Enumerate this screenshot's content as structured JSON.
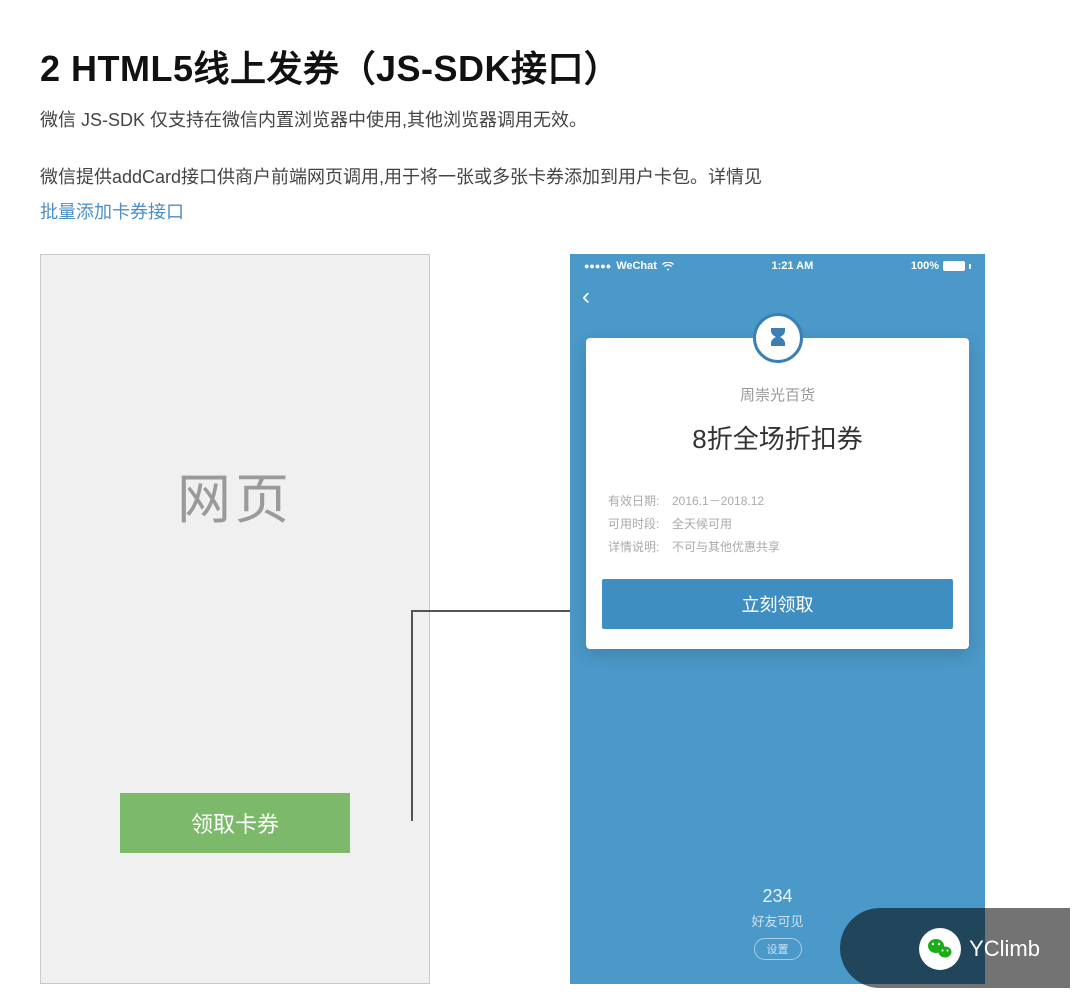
{
  "heading": "2 HTML5线上发券（JS-SDK接口）",
  "para1": "微信 JS-SDK 仅支持在微信内置浏览器中使用,其他浏览器调用无效。",
  "para2": "微信提供addCard接口供商户前端网页调用,用于将一张或多张卡券添加到用户卡包。详情见",
  "link_text": "批量添加卡券接口",
  "webpage": {
    "label": "网页",
    "button": "领取卡券"
  },
  "phone": {
    "status": {
      "carrier": "WeChat",
      "time": "1:21 AM",
      "battery": "100%"
    },
    "merchant": "周崇光百货",
    "coupon_title": "8折全场折扣券",
    "details": [
      {
        "label": "有效日期:",
        "value": "2016.1－2018.12"
      },
      {
        "label": "可用时段:",
        "value": "全天候可用"
      },
      {
        "label": "详情说明:",
        "value": "不可与其他优惠共享"
      }
    ],
    "claim": "立刻领取",
    "bottom_num": "234",
    "bottom_text": "好友可见",
    "settings": "设置"
  },
  "watermark": "YClimb"
}
